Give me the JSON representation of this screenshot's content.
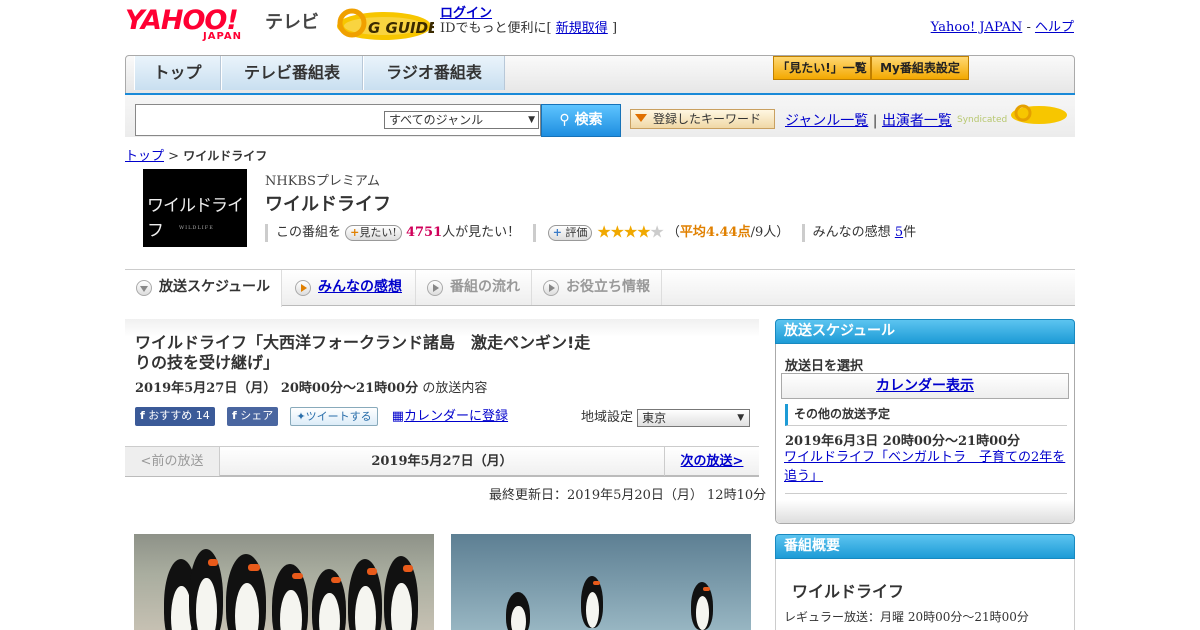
{
  "header": {
    "logo_text": "YAHOO!",
    "logo_sub": "JAPAN",
    "service": "テレビ",
    "gguide_logo": "G GUIDE",
    "login_label": "ログイン",
    "login_note_prefix": "IDでもっと便利に[",
    "signup_label": "新規取得",
    "login_note_suffix": "]",
    "links": [
      {
        "label": "Yahoo! JAPAN"
      },
      {
        "label": "ヘルプ"
      }
    ],
    "link_sep": "-"
  },
  "nav": {
    "tabs": [
      {
        "label": "トップ"
      },
      {
        "label": "テレビ番組表"
      },
      {
        "label": "ラジオ番組表"
      }
    ],
    "mitai_list": "「見たい!」一覧",
    "my_schedule": "My番組表設定"
  },
  "search": {
    "input_value": "",
    "genre_selected": "すべてのジャンル",
    "search_button": "検索",
    "keyword_button": "登録したキーワード",
    "genre_list": "ジャンル一覧",
    "sep": "|",
    "performer_list": "出演者一覧",
    "syndicated": "Syndicated"
  },
  "breadcrumb": {
    "top": "トップ",
    "sep": ">",
    "current": "ワイルドライフ"
  },
  "program": {
    "thumb_title": "ワイルドライフ",
    "thumb_sub": "WILDLIFE",
    "channel": "NHKBSプレミアム",
    "title": "ワイルドライフ",
    "mitai_prefix": "この番組を",
    "mitai_button": "見たい!",
    "mitai_count": "4751",
    "mitai_suffix": "人が見たい！",
    "rate_button": "評価",
    "rating": 4.44,
    "rating_open": "（",
    "rating_avg": "平均4.44点",
    "rating_people": "/9人）",
    "impressions_prefix": "みんなの感想",
    "impressions_count": "5",
    "impressions_suffix": "件"
  },
  "subtabs": [
    {
      "label": "放送スケジュール"
    },
    {
      "label": "みんなの感想"
    },
    {
      "label": "番組の流れ"
    },
    {
      "label": "お役立ち情報"
    }
  ],
  "episode": {
    "title": "ワイルドライフ「大西洋フォークランド諸島　激走ペンギン!走りの技を受け継げ」",
    "date": "2019年5月27日（月）  20時00分～21時00分",
    "date_suffix": "の放送内容",
    "fb_recommend": "おすすめ",
    "fb_count": "14",
    "fb_share": "シェア",
    "tweet": "ツイートする",
    "calendar_register": "カレンダーに登録",
    "region_label": "地域設定",
    "region_value": "東京",
    "prev": "<前の放送",
    "current_date": "2019年5月27日（月）",
    "next": "次の放送>",
    "updated": "最終更新日：2019年5月20日（月）  12時10分"
  },
  "sidebar": {
    "schedule_title": "放送スケジュール",
    "select_day": "放送日を選択",
    "calendar_button": "カレンダー表示",
    "other_title": "その他の放送予定",
    "other_date": "2019年6月3日  20時00分～21時00分",
    "other_link": "ワイルドライフ「ベンガルトラ　子育ての2年を追う」",
    "overview_title": "番組概要",
    "overview_program": "ワイルドライフ",
    "overview_regular": "レギュラー放送：月曜 20時00分～21時00分"
  },
  "colors": {
    "yahoo_red": "#ff0033",
    "accent_blue": "#1d9bd6",
    "link": "#0000cc",
    "mitai_pink": "#d0005a",
    "star": "#f0a800"
  }
}
